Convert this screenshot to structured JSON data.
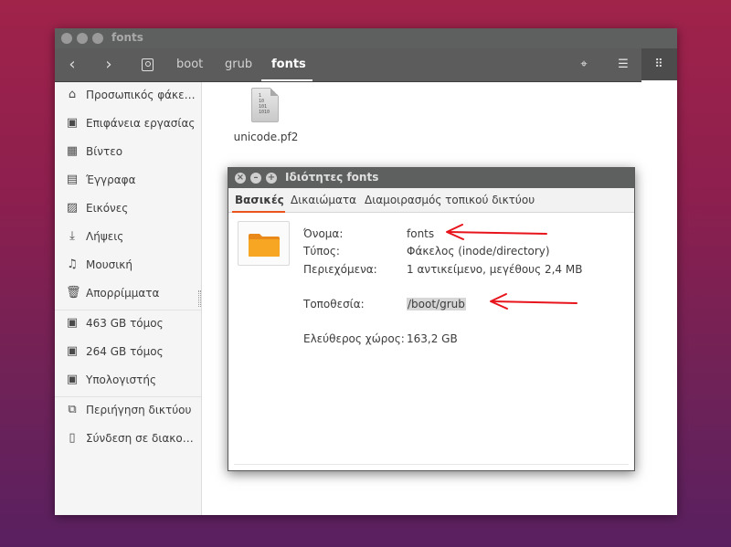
{
  "window": {
    "title": "fonts",
    "breadcrumbs": [
      "boot",
      "grub",
      "fonts"
    ],
    "active_crumb": "fonts"
  },
  "toolbar": {
    "back_icon": "chevron-left-icon",
    "forward_icon": "chevron-right-icon",
    "location_icon": "location-icon",
    "list_view_icon": "list-view-icon",
    "grid_view_icon": "grid-view-icon"
  },
  "sidebar": {
    "items": [
      {
        "label": "Προσωπικός φάκελος",
        "icon": "home-icon"
      },
      {
        "label": "Επιφάνεια εργασίας",
        "icon": "desktop-icon"
      },
      {
        "label": "Βίντεο",
        "icon": "video-icon"
      },
      {
        "label": "Έγγραφα",
        "icon": "document-icon"
      },
      {
        "label": "Εικόνες",
        "icon": "pictures-icon"
      },
      {
        "label": "Λήψεις",
        "icon": "downloads-icon"
      },
      {
        "label": "Μουσική",
        "icon": "music-icon"
      },
      {
        "label": "Απορρίμματα",
        "icon": "trash-icon"
      },
      {
        "label": "463 GB τόμος",
        "icon": "drive-icon"
      },
      {
        "label": "264 GB τόμος",
        "icon": "drive-icon"
      },
      {
        "label": "Υπολογιστής",
        "icon": "computer-icon"
      },
      {
        "label": "Περιήγηση δικτύου",
        "icon": "network-icon"
      },
      {
        "label": "Σύνδεση σε διακομιστή",
        "icon": "server-icon"
      }
    ]
  },
  "files": [
    {
      "name": "unicode.pf2",
      "icon": "binary-file-icon",
      "icon_text": "1\n10\n101\n1010"
    }
  ],
  "dialog": {
    "title": "Ιδιότητες fonts",
    "tabs": [
      "Βασικές",
      "Δικαιώματα",
      "Διαμοιρασμός τοπικού δικτύου"
    ],
    "active_tab": "Βασικές",
    "properties": {
      "name_label": "Όνομα:",
      "name_value": "fonts",
      "type_label": "Τύπος:",
      "type_value": "Φάκελος (inode/directory)",
      "contents_label": "Περιεχόμενα:",
      "contents_value": "1 αντικείμενο, μεγέθους 2,4 MB",
      "location_label": "Τοποθεσία:",
      "location_value": "/boot/grub",
      "free_space_label": "Ελεύθερος χώρος:",
      "free_space_value": "163,2 GB"
    }
  },
  "colors": {
    "accent": "#e95420",
    "titlebar": "#5e5f5f",
    "annotation": "#e8141c",
    "folder": "#f6a623"
  }
}
